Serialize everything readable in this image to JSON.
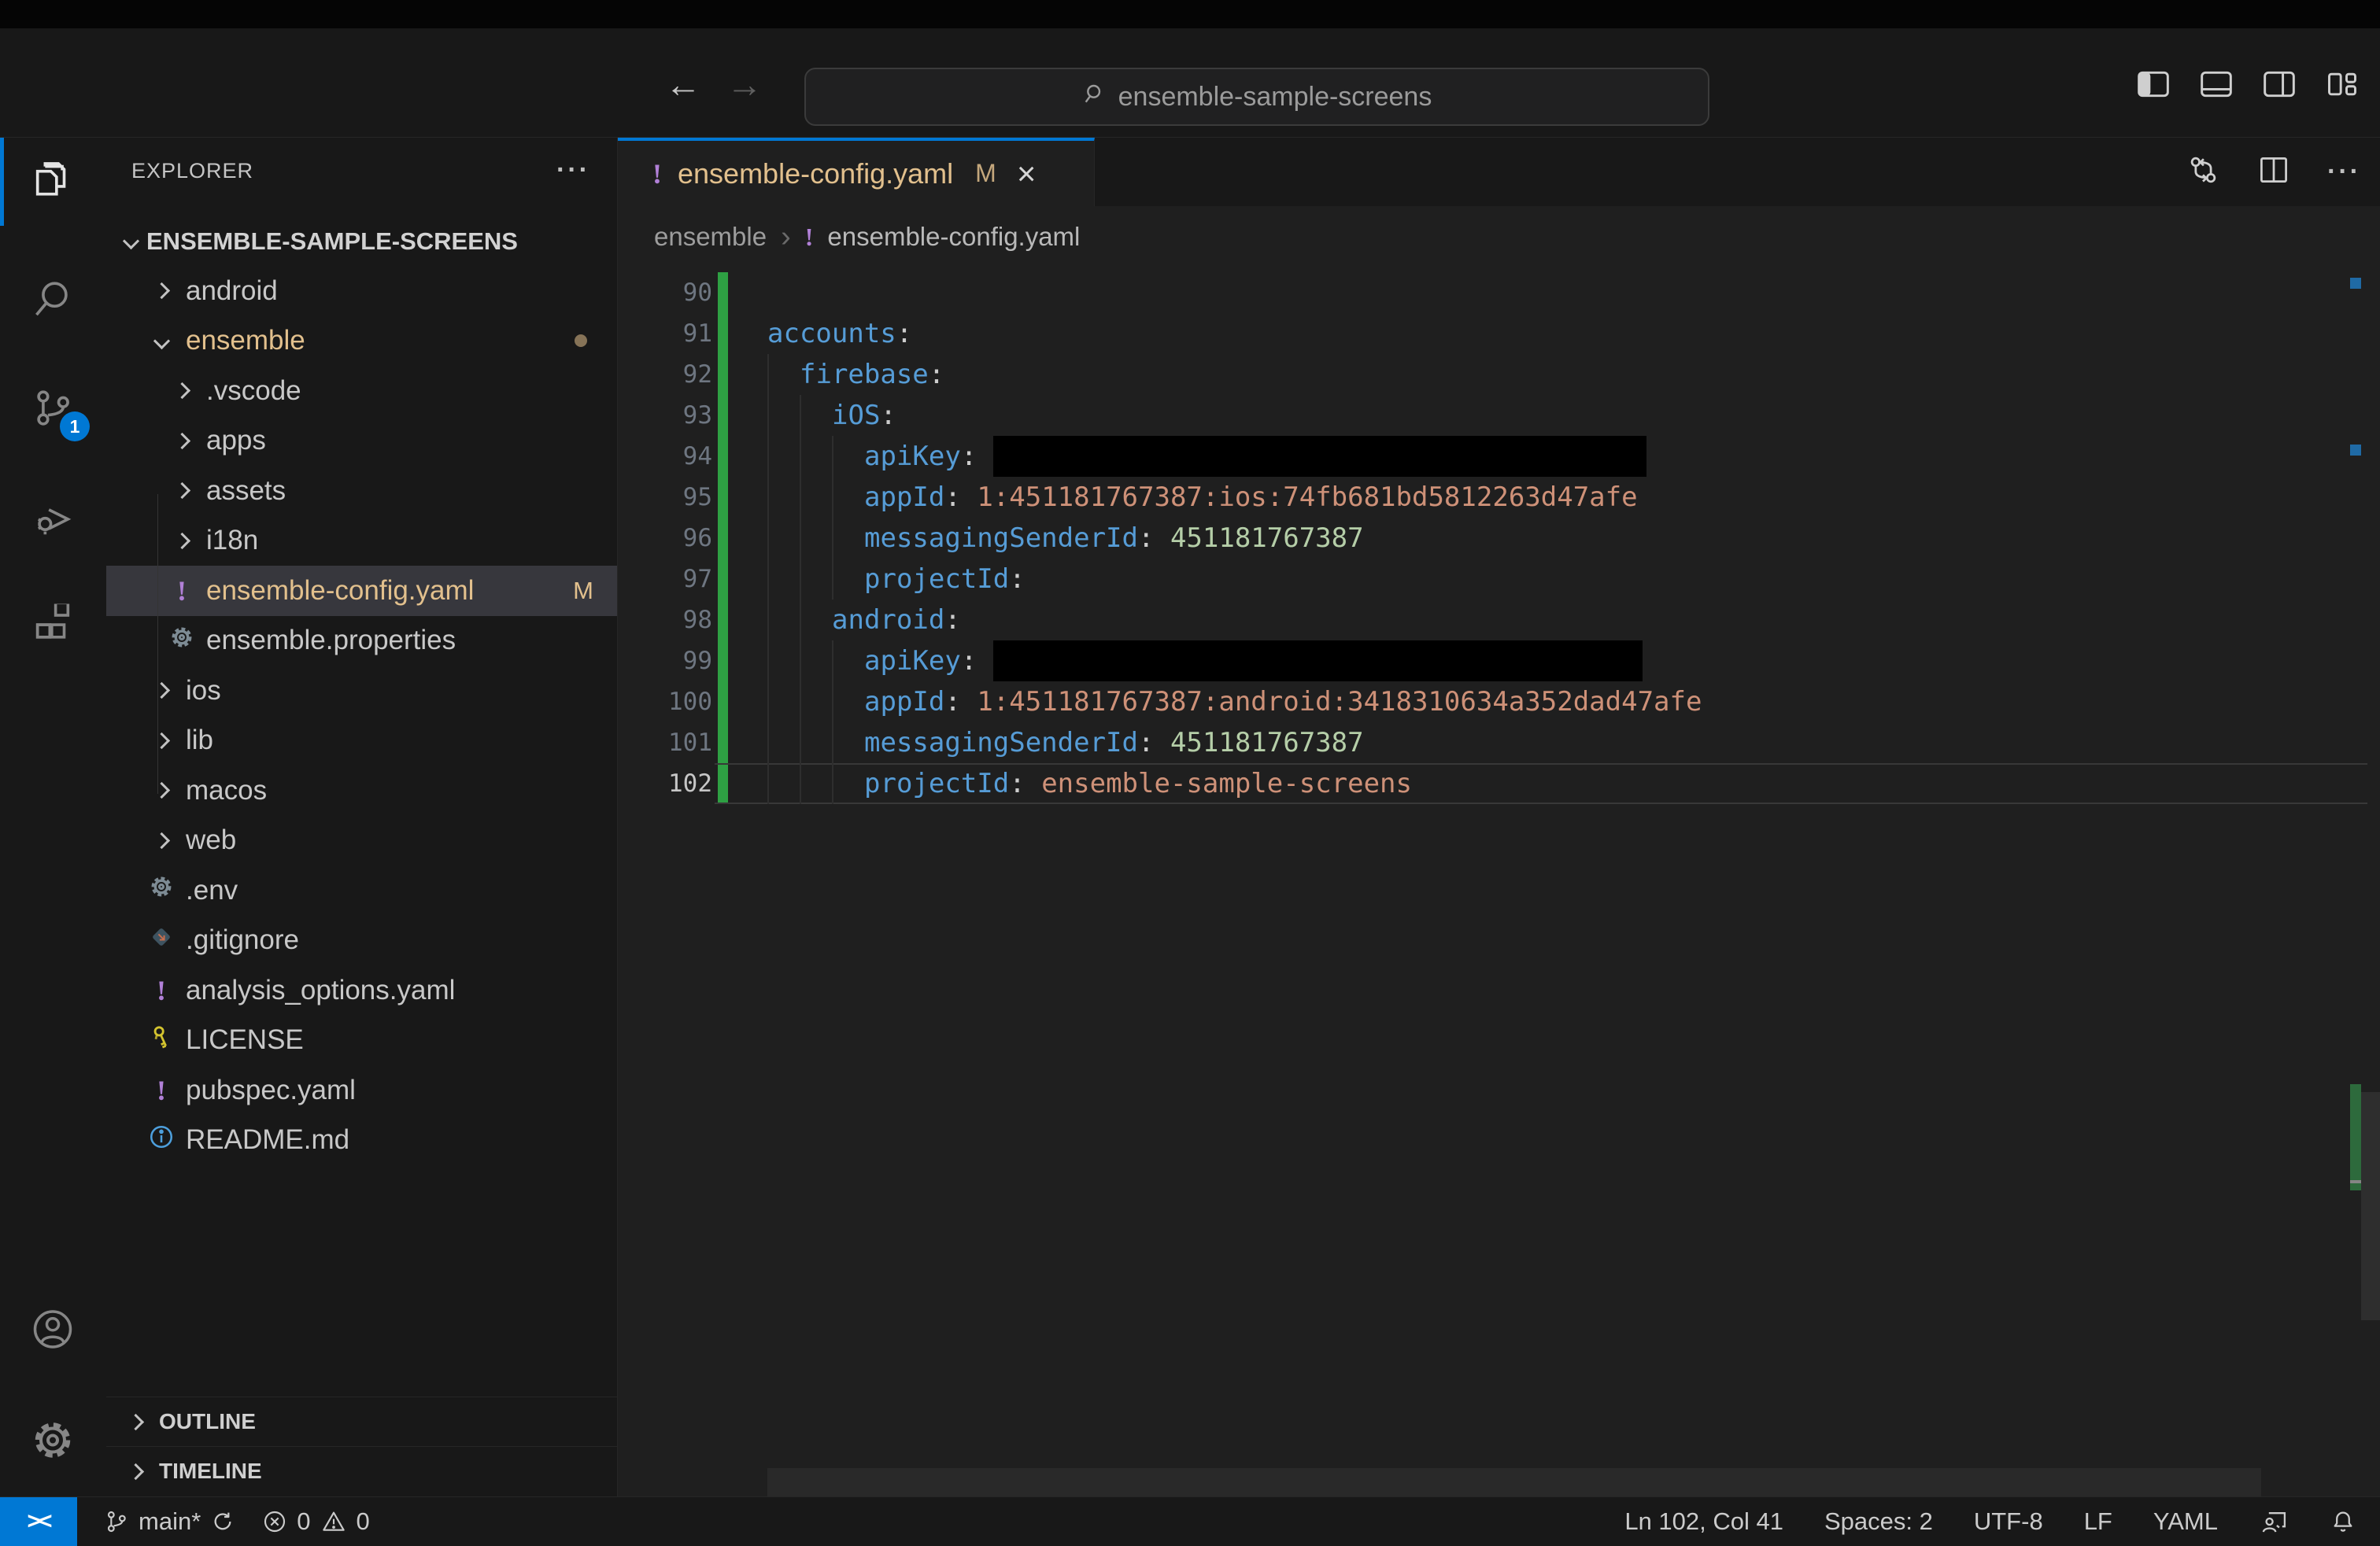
{
  "colors": {
    "accent": "#0078d4",
    "git_modified": "#e2c08d",
    "gutter_added": "#2ea043",
    "yaml_icon": "#b180d7",
    "code_key": "#569cd6",
    "code_string": "#ce9178",
    "code_number": "#b5cea8"
  },
  "icons": {
    "yaml_glyph": "!",
    "more": "···",
    "breadcrumb_sep": "›",
    "close": "×",
    "back": "←",
    "forward": "→",
    "remote": "><"
  },
  "title_bar": {
    "search": "ensemble-sample-screens"
  },
  "activity_bar": {
    "scm_badge": "1"
  },
  "sidebar": {
    "title": "EXPLORER",
    "root": "ENSEMBLE-SAMPLE-SCREENS",
    "outline": "OUTLINE",
    "timeline": "TIMELINE",
    "files": [
      {
        "label": "android",
        "kind": "folder",
        "level": 1
      },
      {
        "label": "ensemble",
        "kind": "folder-open",
        "level": 1,
        "modified": true,
        "dot": true
      },
      {
        "label": ".vscode",
        "kind": "folder",
        "level": 2
      },
      {
        "label": "apps",
        "kind": "folder",
        "level": 2
      },
      {
        "label": "assets",
        "kind": "folder",
        "level": 2
      },
      {
        "label": "i18n",
        "kind": "folder",
        "level": 2
      },
      {
        "label": "ensemble-config.yaml",
        "kind": "file",
        "icon": "yaml",
        "level": 2,
        "modified": true,
        "badge": "M",
        "selected": true
      },
      {
        "label": "ensemble.properties",
        "kind": "file",
        "icon": "gear",
        "level": 2
      },
      {
        "label": "ios",
        "kind": "folder",
        "level": 1
      },
      {
        "label": "lib",
        "kind": "folder",
        "level": 1
      },
      {
        "label": "macos",
        "kind": "folder",
        "level": 1
      },
      {
        "label": "web",
        "kind": "folder",
        "level": 1
      },
      {
        "label": ".env",
        "kind": "file",
        "icon": "gear",
        "level": 1
      },
      {
        "label": ".gitignore",
        "kind": "file",
        "icon": "git",
        "level": 1
      },
      {
        "label": "analysis_options.yaml",
        "kind": "file",
        "icon": "yaml",
        "level": 1
      },
      {
        "label": "LICENSE",
        "kind": "file",
        "icon": "key",
        "level": 1
      },
      {
        "label": "pubspec.yaml",
        "kind": "file",
        "icon": "yaml",
        "level": 1
      },
      {
        "label": "README.md",
        "kind": "file",
        "icon": "info",
        "level": 1
      }
    ]
  },
  "editor": {
    "tab": {
      "label": "ensemble-config.yaml",
      "modified_badge": "M"
    },
    "breadcrumb": {
      "folder": "ensemble",
      "file": "ensemble-config.yaml"
    },
    "code": {
      "language": "yaml",
      "lines": [
        {
          "num": "90",
          "tokens": []
        },
        {
          "num": "91",
          "tokens": [
            [
              "key",
              "accounts"
            ],
            [
              "punct",
              ":"
            ]
          ]
        },
        {
          "num": "92",
          "tokens": [
            [
              "ind",
              "1"
            ],
            [
              "key",
              "firebase"
            ],
            [
              "punct",
              ":"
            ]
          ]
        },
        {
          "num": "93",
          "tokens": [
            [
              "ind",
              "2"
            ],
            [
              "key",
              "iOS"
            ],
            [
              "punct",
              ":"
            ]
          ]
        },
        {
          "num": "94",
          "tokens": [
            [
              "ind",
              "3"
            ],
            [
              "key",
              "apiKey"
            ],
            [
              "punct",
              ": "
            ],
            [
              "redact",
              "830"
            ]
          ]
        },
        {
          "num": "95",
          "tokens": [
            [
              "ind",
              "3"
            ],
            [
              "key",
              "appId"
            ],
            [
              "punct",
              ": "
            ],
            [
              "str",
              "1:451181767387:ios:74fb681bd5812263d47afe"
            ]
          ]
        },
        {
          "num": "96",
          "tokens": [
            [
              "ind",
              "3"
            ],
            [
              "key",
              "messagingSenderId"
            ],
            [
              "punct",
              ": "
            ],
            [
              "num",
              "451181767387"
            ]
          ]
        },
        {
          "num": "97",
          "tokens": [
            [
              "ind",
              "3"
            ],
            [
              "key",
              "projectId"
            ],
            [
              "punct",
              ":"
            ]
          ]
        },
        {
          "num": "98",
          "tokens": [
            [
              "ind",
              "2"
            ],
            [
              "key",
              "android"
            ],
            [
              "punct",
              ":"
            ]
          ]
        },
        {
          "num": "99",
          "tokens": [
            [
              "ind",
              "3"
            ],
            [
              "key",
              "apiKey"
            ],
            [
              "punct",
              ": "
            ],
            [
              "redact",
              "825"
            ]
          ]
        },
        {
          "num": "100",
          "tokens": [
            [
              "ind",
              "3"
            ],
            [
              "key",
              "appId"
            ],
            [
              "punct",
              ": "
            ],
            [
              "str",
              "1:451181767387:android:3418310634a352dad47afe"
            ]
          ]
        },
        {
          "num": "101",
          "tokens": [
            [
              "ind",
              "3"
            ],
            [
              "key",
              "messagingSenderId"
            ],
            [
              "punct",
              ": "
            ],
            [
              "num",
              "451181767387"
            ]
          ]
        },
        {
          "num": "102",
          "tokens": [
            [
              "ind",
              "3"
            ],
            [
              "key",
              "projectId"
            ],
            [
              "punct",
              ": "
            ],
            [
              "str",
              "ensemble-sample-screens"
            ]
          ],
          "current": true
        }
      ]
    }
  },
  "status_bar": {
    "branch": "main*",
    "errors": "0",
    "warnings": "0",
    "cursor": "Ln 102, Col 41",
    "indentation": "Spaces: 2",
    "encoding": "UTF-8",
    "eol": "LF",
    "language": "YAML"
  }
}
